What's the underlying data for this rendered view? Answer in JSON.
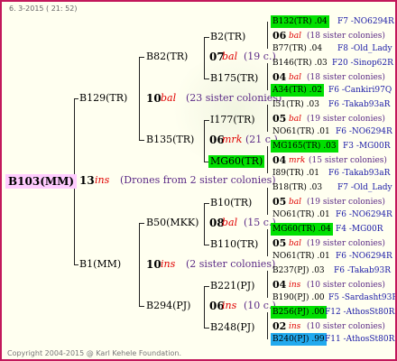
{
  "header": {
    "date": "6. 3-2015 ( 21: 52)"
  },
  "footer": {
    "copyright": "Copyright 2004-2015 @ Karl Kehele Foundation."
  },
  "root": {
    "id": "B103(MM)",
    "age": "13",
    "kind": "ins",
    "note": "(Drones from 2 sister colonies)"
  },
  "gen1": [
    {
      "id": "B129(TR)",
      "age": "10",
      "kind": "bal",
      "note": "(23 sister colonies)"
    },
    {
      "id": "B1(MM)",
      "age": "10",
      "kind": "ins",
      "note": "(2 sister colonies)"
    }
  ],
  "gen2": [
    {
      "id": "B82(TR)",
      "age": "07",
      "kind": "bal",
      "note": "(19 c.)"
    },
    {
      "id": "B135(TR)",
      "age": "06",
      "kind": "mrk",
      "note": "(21 c.)"
    },
    {
      "id": "B50(MKK)",
      "age": "08",
      "kind": "bal",
      "note": "(15 c.)"
    },
    {
      "id": "B294(PJ)",
      "age": "06",
      "kind": "ins",
      "note": "(10 c.)"
    }
  ],
  "gen3": [
    {
      "id": "B2(TR)"
    },
    {
      "id": "B175(TR)"
    },
    {
      "id": "I177(TR)"
    },
    {
      "id": "MG60(TR)"
    },
    {
      "id": "B10(TR)"
    },
    {
      "id": "B110(TR)"
    },
    {
      "id": "B221(PJ)"
    },
    {
      "id": "B248(PJ)"
    }
  ],
  "gen4": [
    {
      "id": "B132(TR) .04",
      "right": "F7 -NO6294R",
      "hl": "green"
    },
    {
      "age": "06",
      "kind": "bal",
      "note": "(18 sister colonies)"
    },
    {
      "id": "B77(TR) .04",
      "right": "F8 -Old_Lady"
    },
    {
      "id": "B146(TR) .03",
      "right": "F20 -Sinop62R"
    },
    {
      "age": "04",
      "kind": "bal",
      "note": "(18 sister colonies)"
    },
    {
      "id": "A34(TR) .02",
      "right": "F6 -Cankiri97Q",
      "hl": "green"
    },
    {
      "id": "I51(TR) .03",
      "right": "F6 -Takab93aR"
    },
    {
      "age": "05",
      "kind": "bal",
      "note": "(19 sister colonies)"
    },
    {
      "id": "NO61(TR) .01",
      "right": "F6 -NO6294R"
    },
    {
      "id": "MG165(TR) .03",
      "right": "F3 -MG00R",
      "hl": "green"
    },
    {
      "age": "04",
      "kind": "mrk",
      "note": "(15 sister colonies)"
    },
    {
      "id": "I89(TR) .01",
      "right": "F6 -Takab93aR"
    },
    {
      "id": "B18(TR) .03",
      "right": "F7 -Old_Lady"
    },
    {
      "age": "05",
      "kind": "bal",
      "note": "(19 sister colonies)"
    },
    {
      "id": "NO61(TR) .01",
      "right": "F6 -NO6294R"
    },
    {
      "id": "MG60(TR) .04",
      "right": "F4 -MG00R",
      "hl": "green"
    },
    {
      "age": "05",
      "kind": "bal",
      "note": "(19 sister colonies)"
    },
    {
      "id": "NO61(TR) .01",
      "right": "F6 -NO6294R"
    },
    {
      "id": "B237(PJ) .03",
      "right": "F6 -Takab93R"
    },
    {
      "age": "04",
      "kind": "ins",
      "note": "(10 sister colonies)"
    },
    {
      "id": "B190(PJ) .00",
      "right": "F5 -Sardasht93R"
    },
    {
      "id": "B256(PJ) .00",
      "right": "F12 -AthosSt80R",
      "hl": "green"
    },
    {
      "age": "02",
      "kind": "ins",
      "note": "(10 sister colonies)"
    },
    {
      "id": "B240(PJ) .99",
      "right": "F11 -AthosSt80R",
      "hl": "blue"
    }
  ]
}
